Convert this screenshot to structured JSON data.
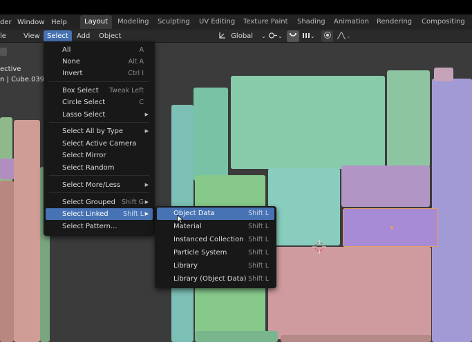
{
  "menubar": {
    "items": [
      "der",
      "Window",
      "Help"
    ],
    "workspaces": [
      {
        "label": "Layout",
        "active": true
      },
      {
        "label": "Modeling",
        "active": false
      },
      {
        "label": "Sculpting",
        "active": false
      },
      {
        "label": "UV Editing",
        "active": false
      },
      {
        "label": "Texture Paint",
        "active": false
      },
      {
        "label": "Shading",
        "active": false
      },
      {
        "label": "Animation",
        "active": false
      },
      {
        "label": "Rendering",
        "active": false
      },
      {
        "label": "Compositing",
        "active": false
      }
    ]
  },
  "header": {
    "mode_partial": "le",
    "view": "View",
    "select": "Select",
    "add": "Add",
    "object": "Object",
    "transform_orientation": "Global"
  },
  "viewport": {
    "overlay_line1": "ective",
    "overlay_line2": "n | Cube.039"
  },
  "select_menu": {
    "items": [
      {
        "label": "All",
        "shortcut": "A"
      },
      {
        "label": "None",
        "shortcut": "Alt A"
      },
      {
        "label": "Invert",
        "shortcut": "Ctrl I"
      },
      {
        "label": "Box Select",
        "shortcut": "Tweak Left"
      },
      {
        "label": "Circle Select",
        "shortcut": "C"
      },
      {
        "label": "Lasso Select",
        "shortcut": ""
      },
      {
        "label": "Select All by Type",
        "shortcut": ""
      },
      {
        "label": "Select Active Camera",
        "shortcut": ""
      },
      {
        "label": "Select Mirror",
        "shortcut": ""
      },
      {
        "label": "Select Random",
        "shortcut": ""
      },
      {
        "label": "Select More/Less",
        "shortcut": ""
      },
      {
        "label": "Select Grouped",
        "shortcut": "Shift G"
      },
      {
        "label": "Select Linked",
        "shortcut": "Shift L"
      },
      {
        "label": "Select Pattern...",
        "shortcut": ""
      }
    ]
  },
  "linked_submenu": {
    "items": [
      {
        "label": "Object Data",
        "shortcut": "Shift L"
      },
      {
        "label": "Material",
        "shortcut": "Shift L"
      },
      {
        "label": "Instanced Collection",
        "shortcut": "Shift L"
      },
      {
        "label": "Particle System",
        "shortcut": "Shift L"
      },
      {
        "label": "Library",
        "shortcut": "Shift L"
      },
      {
        "label": "Library (Object Data)",
        "shortcut": "Shift L"
      }
    ]
  },
  "colors": {
    "highlight": "#4772b3",
    "teal": "#7bbfb1",
    "green": "#85c28c",
    "purple": "#a28fd0",
    "pink": "#c39090",
    "violet": "#a583b8",
    "selected_outline": "#e8a060"
  },
  "icons": [
    "select-box-icon",
    "transform-orientation-icon",
    "chevron-down-icon",
    "pivot-icon",
    "snap-icon",
    "snap-increment-icon",
    "proportional-edit-icon",
    "falloff-icon",
    "submenu-arrow-icon",
    "mouse-cursor-icon"
  ]
}
